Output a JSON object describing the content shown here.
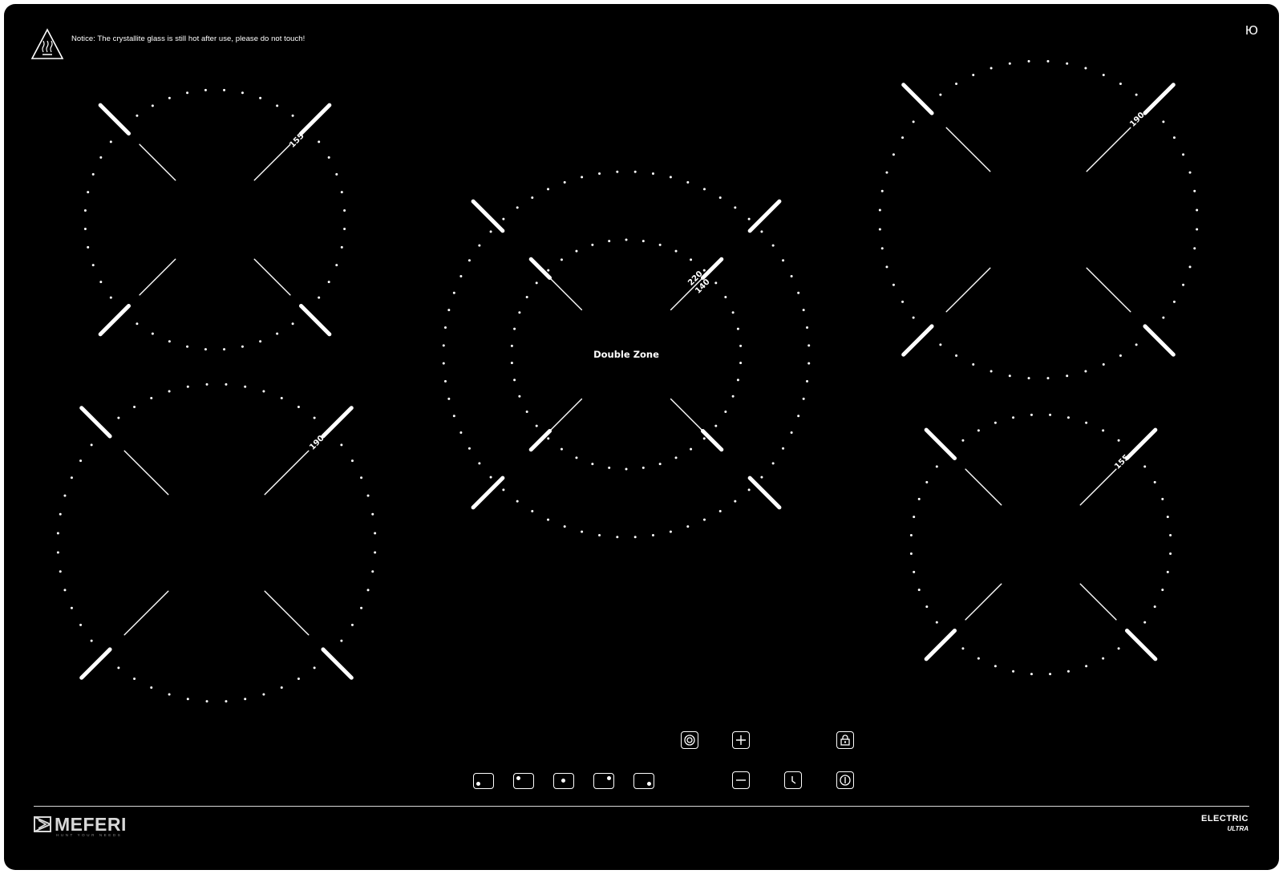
{
  "notice": {
    "text": "Notice: The crystallite glass is still hot after use, please do not touch!",
    "icon": "hot-surface-warning-icon"
  },
  "corner_mark": "Ю",
  "zones": [
    {
      "name": "rear-left",
      "diameter_label": "155"
    },
    {
      "name": "front-left",
      "diameter_label": "190"
    },
    {
      "name": "center-double",
      "label": "Double Zone",
      "diameter_label_outer": "220",
      "diameter_label_inner": "140"
    },
    {
      "name": "rear-right",
      "diameter_label": "190"
    },
    {
      "name": "front-right",
      "diameter_label": "155"
    }
  ],
  "controls": {
    "zone_selectors": [
      "front-left-selector-icon",
      "rear-left-selector-icon",
      "center-selector-icon",
      "rear-right-selector-icon",
      "front-right-selector-icon"
    ],
    "dual_zone": "dual-zone-icon",
    "plus": "plus-icon",
    "minus": "minus-icon",
    "lock": "lock-icon",
    "timer": "timer-icon",
    "power": "power-icon"
  },
  "brand": {
    "name": "MEFERI",
    "tagline": "HUNT YOUR NEEDS"
  },
  "model": {
    "line": "ELECTRIC",
    "sub": "ULTRA"
  },
  "colors": {
    "glass": "#000000",
    "print": "#ffffff",
    "brand_grey": "#d9d9d9"
  }
}
